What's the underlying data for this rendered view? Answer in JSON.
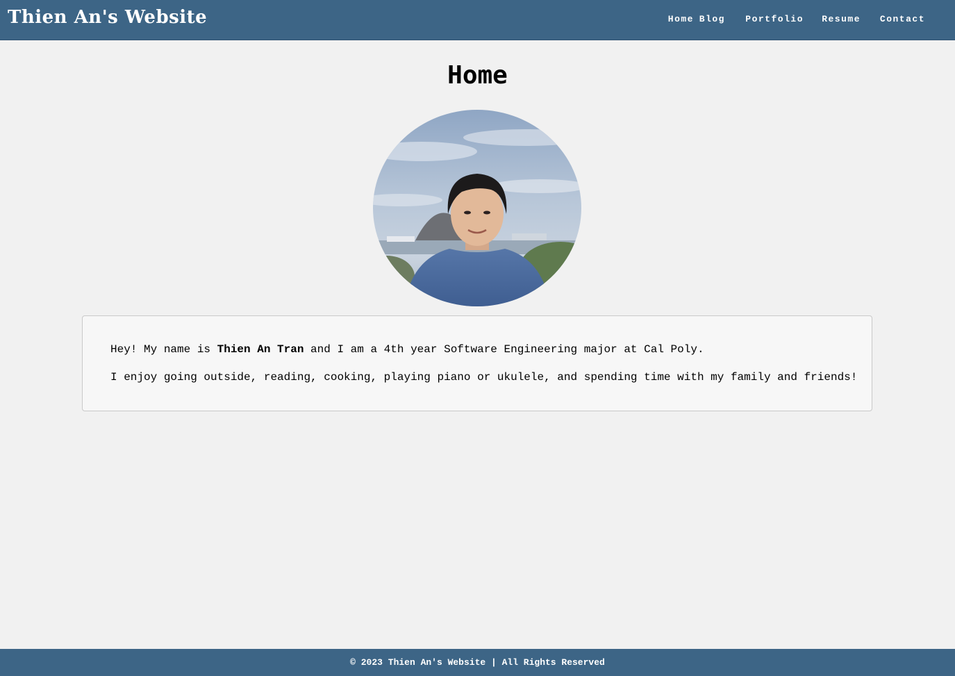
{
  "header": {
    "site_title": "Thien An's Website",
    "nav": [
      {
        "label": "Home"
      },
      {
        "label": "Blog"
      },
      {
        "label": "Portfolio"
      },
      {
        "label": "Resume"
      },
      {
        "label": "Contact"
      }
    ]
  },
  "main": {
    "heading": "Home",
    "profile_photo": {
      "alt": "Thien An Tran"
    },
    "intro": {
      "line1_before": "Hey! My name is ",
      "line1_name": "Thien An Tran",
      "line1_after": " and I am a 4th year Software Engineering major at Cal Poly.",
      "line2": "I enjoy going outside, reading, cooking, playing piano or ukulele, and spending time with my family and friends!"
    }
  },
  "footer": {
    "text": "© 2023 Thien An's Website | All Rights Reserved"
  },
  "colors": {
    "header_bg": "#3d6586",
    "page_bg": "#f1f1f1",
    "card_bg": "#f7f7f7",
    "card_border": "#c9c9c9"
  }
}
